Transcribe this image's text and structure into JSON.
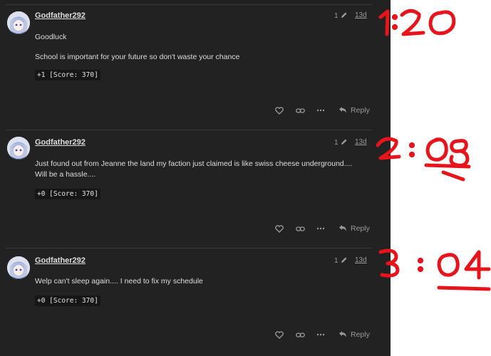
{
  "posts": [
    {
      "username": "Godfather292",
      "edit_count": "1",
      "date": "13d",
      "lines": [
        "Goodluck",
        "School is important for your future so don't waste your chance"
      ],
      "code": "+1 [Score: 370]",
      "reply_label": "Reply",
      "annotation": "1:20"
    },
    {
      "username": "Godfather292",
      "edit_count": "1",
      "date": "13d",
      "lines": [
        "Just found out from Jeanne the land my faction just claimed is like swiss cheese underground.... Will be a hassle...."
      ],
      "code": "+0 [Score: 370]",
      "reply_label": "Reply",
      "annotation": "2:08"
    },
    {
      "username": "Godfather292",
      "edit_count": "1",
      "date": "13d",
      "lines": [
        "Welp can't sleep again.... I need to fix my schedule"
      ],
      "code": "+0 [Score: 370]",
      "reply_label": "Reply",
      "annotation": "3:04"
    }
  ],
  "colors": {
    "background": "#222222",
    "text": "#dddddd",
    "muted": "#9a9a9a",
    "annotation": "#e8141c"
  },
  "icons": [
    "heart-icon",
    "link-icon",
    "more-options-icon",
    "reply-arrow-icon",
    "pencil-icon"
  ]
}
